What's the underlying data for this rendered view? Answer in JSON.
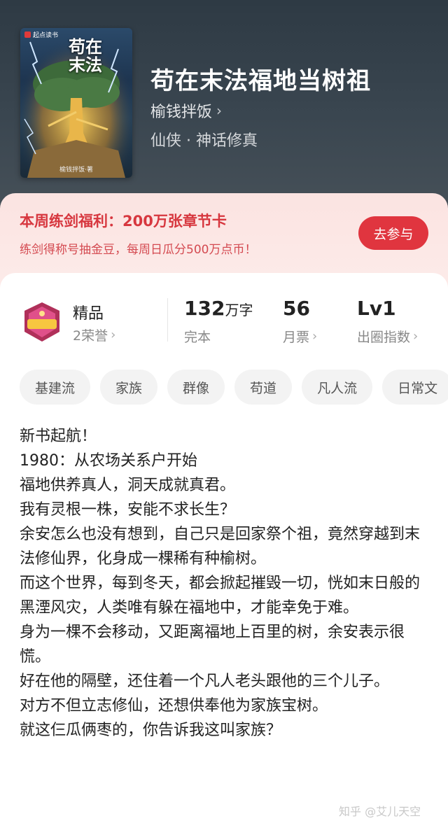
{
  "cover": {
    "publisher": "起点读书",
    "title_art": "苟在末法",
    "author_art": "榆钱拌饭·著"
  },
  "book": {
    "title": "苟在末法福地当树祖",
    "author": "榆钱拌饭",
    "genre": "仙侠 · 神话修真"
  },
  "promo": {
    "title": "本周练剑福利：200万张章节卡",
    "subtitle": "练剑得称号抽金豆，每周日瓜分500万点币！",
    "button": "去参与"
  },
  "stats": {
    "quality": "精品",
    "honors": "2荣誉",
    "words_num": "132",
    "words_unit": "万字",
    "status": "完本",
    "tickets_num": "56",
    "tickets_label": "月票",
    "level": "Lv1",
    "level_label": "出圈指数"
  },
  "tags": [
    "基建流",
    "家族",
    "群像",
    "苟道",
    "凡人流",
    "日常文"
  ],
  "description": [
    "新书起航！",
    "1980：从农场关系户开始",
    "福地供养真人，洞天成就真君。",
    "我有灵根一株，安能不求长生？",
    "余安怎么也没有想到，自己只是回家祭个祖，竟然穿越到末法修仙界，化身成一棵稀有种榆树。",
    "而这个世界，每到冬天，都会掀起摧毁一切，恍如末日般的黑湮风灾，人类唯有躲在福地中，才能幸免于难。",
    "身为一棵不会移动，又距离福地上百里的树，余安表示很慌。",
    "好在他的隔壁，还住着一个凡人老头跟他的三个儿子。",
    "对方不但立志修仙，还想供奉他为家族宝树。",
    "就这仨瓜俩枣的，你告诉我这叫家族？"
  ],
  "watermark": "知乎 @艾儿天空",
  "colors": {
    "accent": "#e0353f",
    "promo_bg": "#fce6e4",
    "hero_bg": "#36424c"
  }
}
